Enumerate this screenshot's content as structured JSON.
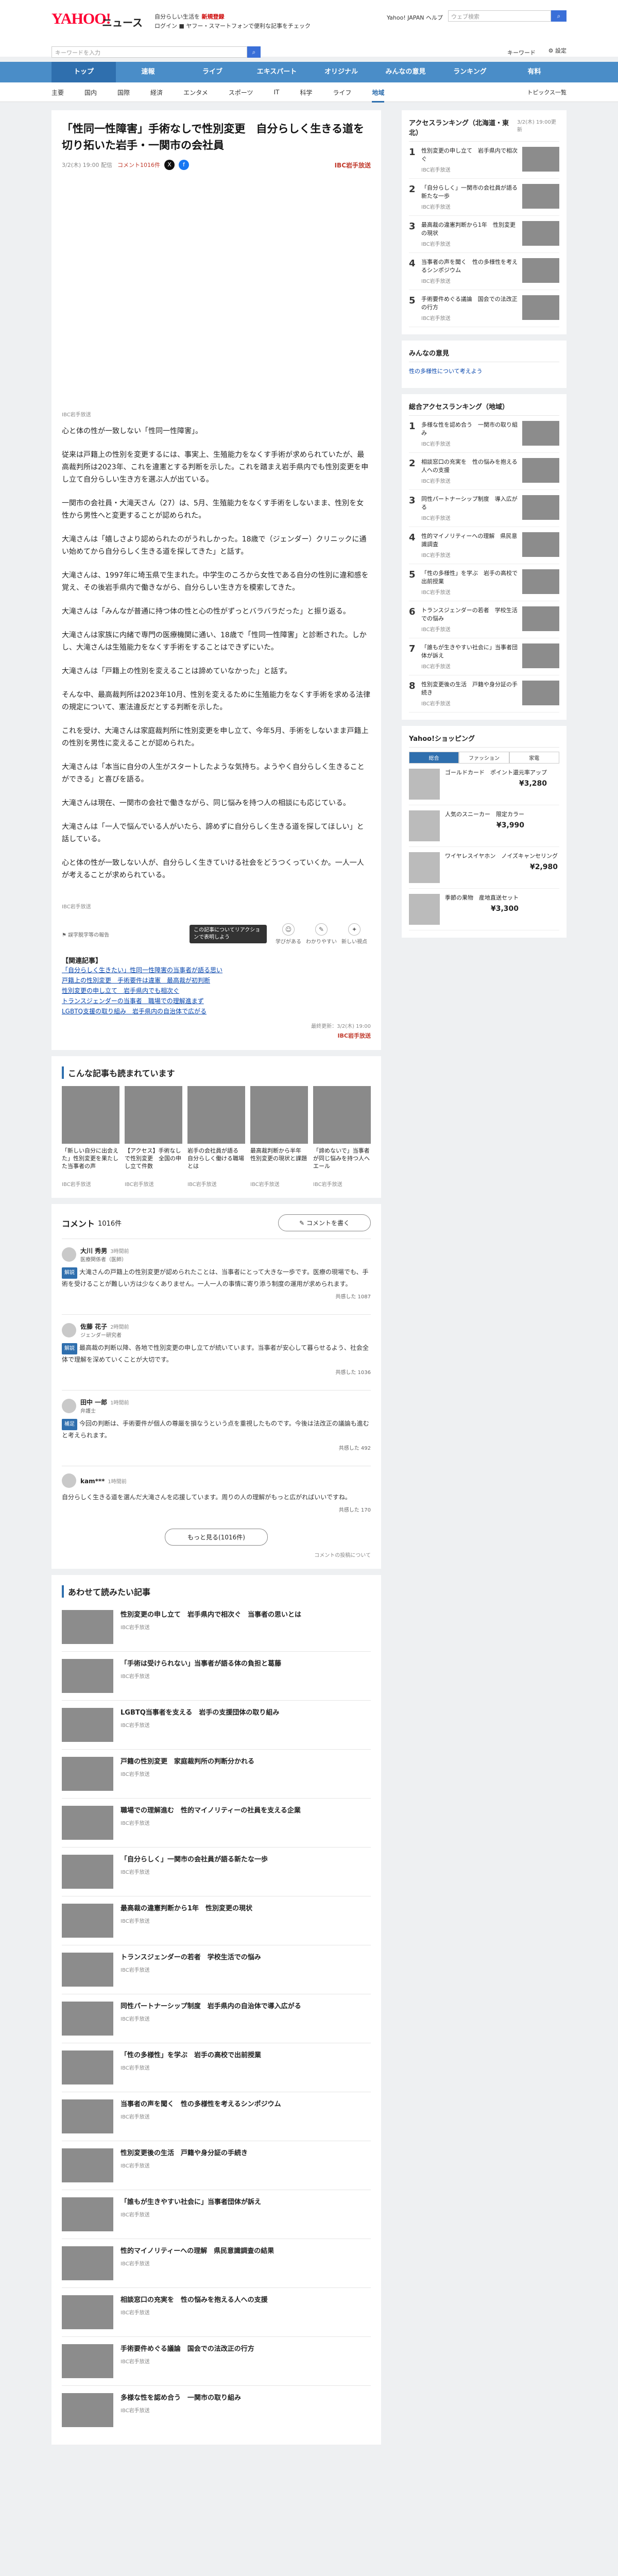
{
  "header": {
    "logo": "YAHOO!",
    "logo_news": "ニュース",
    "promo_line1_pre": "自分らしい生活を",
    "promo_line1_strong": "新規登録",
    "promo_line2": "ログイン ■ ヤフー・スマートフォンで便利な記事をチェック",
    "top_links": "Yahoo! JAPAN ヘルプ",
    "top_search_placeholder": "ウェブ検索",
    "news_search_placeholder": "キーワードを入力",
    "keywords": "キーワード",
    "settings": "設定"
  },
  "nav": {
    "items": [
      "トップ",
      "速報",
      "ライブ",
      "エキスパート",
      "オリジナル",
      "みんなの意見",
      "ランキング",
      "有料"
    ],
    "active": 0
  },
  "subnav": {
    "items": [
      "主要",
      "国内",
      "国際",
      "経済",
      "エンタメ",
      "スポーツ",
      "IT",
      "科学",
      "ライフ",
      "地域"
    ],
    "active": 9,
    "topics_link": "トピックス一覧"
  },
  "article": {
    "title": "「性同一性障害」手術なしで性別変更　自分らしく生きる道を切り拓いた岩手・一関市の会社員",
    "date": "3/2(木) 19:00 配信",
    "comments_label": "コメント1016件",
    "source": "IBC岩手放送",
    "video_caption": "IBC岩手放送",
    "paragraphs": [
      "心と体の性が一致しない「性同一性障害」。",
      "従来は戸籍上の性別を変更するには、事実上、生殖能力をなくす手術が求められていたが、最高裁判所は2023年、これを違憲とする判断を示した。これを踏まえ岩手県内でも性別変更を申し立て自分らしい生き方を選ぶ人が出ている。",
      "一関市の会社員・大滝天さん（27）は、5月、生殖能力をなくす手術をしないまま、性別を女性から男性へと変更することが認められた。",
      "大滝さんは「嬉しさより認められたのがうれしかった。18歳で（ジェンダー）クリニックに通い始めてから自分らしく生きる道を探してきた」と話す。",
      "大滝さんは、1997年に埼玉県で生まれた。中学生のころから女性である自分の性別に違和感を覚え、その後岩手県内で働きながら、自分らしい生き方を模索してきた。",
      "大滝さんは「みんなが普通に持つ体の性と心の性がずっとバラバラだった」と振り返る。",
      "大滝さんは家族に内緒で専門の医療機関に通い、18歳で「性同一性障害」と診断された。しかし、大滝さんは生殖能力をなくす手術をすることはできずにいた。",
      "大滝さんは「戸籍上の性別を変えることは諦めていなかった」と話す。",
      "そんな中、最高裁判所は2023年10月、性別を変えるために生殖能力をなくす手術を求める法律の規定について、憲法違反だとする判断を示した。",
      "これを受け、大滝さんは家庭裁判所に性別変更を申し立て、今年5月、手術をしないまま戸籍上の性別を男性に変えることが認められた。",
      "大滝さんは「本当に自分の人生がスタートしたような気持ち。ようやく自分らしく生きることができる」と喜びを語る。",
      "大滝さんは現在、一関市の会社で働きながら、同じ悩みを持つ人の相談にも応じている。",
      "大滝さんは「一人で悩んでいる人がいたら、諦めずに自分らしく生きる道を探してほしい」と話している。",
      "心と体の性が一致しない人が、自分らしく生きていける社会をどうつくっていくか。一人一人が考えることが求められている。"
    ],
    "end_source": "IBC岩手放送",
    "error_report": "誤字脱字等の報告",
    "tooltip": "この記事についてリアクションで表明しよう",
    "reactions": [
      {
        "icon": "☺",
        "label": "学びがある"
      },
      {
        "icon": "✎",
        "label": "わかりやすい"
      },
      {
        "icon": "✦",
        "label": "新しい視点"
      }
    ],
    "related_heading": "【関連記事】",
    "related": [
      "「自分らしく生きたい」性同一性障害の当事者が語る思い",
      "戸籍上の性別変更　手術要件は違憲　最高裁が初判断",
      "性別変更の申し立て　岩手県内でも相次ぐ",
      "トランスジェンダーの当事者　職場での理解進まず",
      "LGBTQ支援の取り組み　岩手県内の自治体で広がる"
    ],
    "timestamp": "最終更新：3/2(木) 19:00",
    "timestamp_source": "IBC岩手放送"
  },
  "recommend": {
    "heading": "こんな記事も読まれています",
    "items": [
      {
        "title": "「新しい自分に出会えた」性別変更を果たした当事者の声",
        "source": "IBC岩手放送"
      },
      {
        "title": "【アクセス】手術なしで性別変更　全国の申し立て件数",
        "source": "IBC岩手放送"
      },
      {
        "title": "岩手の会社員が語る　自分らしく働ける職場とは",
        "source": "IBC岩手放送"
      },
      {
        "title": "最高裁判断から半年　性別変更の現状と課題",
        "source": "IBC岩手放送"
      },
      {
        "title": "「諦めないで」当事者が同じ悩みを持つ人へエール",
        "source": "IBC岩手放送"
      }
    ]
  },
  "comments": {
    "title": "コメント",
    "count": "1016件",
    "write_button": "コメントを書く",
    "items": [
      {
        "name": "大川 秀男",
        "time": "3時間前",
        "role": "医療関係者（医師）",
        "tag": "解説",
        "text": "大滝さんの戸籍上の性別変更が認められたことは、当事者にとって大きな一歩です。医療の現場でも、手術を受けることが難しい方は少なくありません。一人一人の事情に寄り添う制度の運用が求められます。",
        "likes": "共感した 1087"
      },
      {
        "name": "佐藤 花子",
        "time": "2時間前",
        "role": "ジェンダー研究者",
        "tag": "解説",
        "text": "最高裁の判断以降、各地で性別変更の申し立てが続いています。当事者が安心して暮らせるよう、社会全体で理解を深めていくことが大切です。",
        "likes": "共感した 1036"
      },
      {
        "name": "田中 一郎",
        "time": "1時間前",
        "role": "弁護士",
        "tag": "補足",
        "text": "今回の判断は、手術要件が個人の尊厳を損なうという点を重視したものです。今後は法改正の議論も進むと考えられます。",
        "likes": "共感した 492"
      },
      {
        "name": "kam***",
        "time": "1時間前",
        "role": "",
        "tag": "",
        "text": "自分らしく生きる道を選んだ大滝さんを応援しています。周りの人の理解がもっと広がればいいですね。",
        "likes": "共感した 170"
      }
    ],
    "more_button": "もっと見る(1016件)",
    "note": "コメントの投稿について"
  },
  "also_read": {
    "heading": "あわせて読みたい記事",
    "items": [
      {
        "title": "性別変更の申し立て　岩手県内で相次ぐ　当事者の思いとは",
        "source": "IBC岩手放送"
      },
      {
        "title": "「手術は受けられない」当事者が語る体の負担と葛藤",
        "source": "IBC岩手放送"
      },
      {
        "title": "LGBTQ当事者を支える　岩手の支援団体の取り組み",
        "source": "IBC岩手放送"
      },
      {
        "title": "戸籍の性別変更　家庭裁判所の判断分かれる",
        "source": "IBC岩手放送"
      },
      {
        "title": "職場での理解進む　性的マイノリティーの社員を支える企業",
        "source": "IBC岩手放送"
      },
      {
        "title": "「自分らしく」一関市の会社員が語る新たな一歩",
        "source": "IBC岩手放送"
      },
      {
        "title": "最高裁の違憲判断から1年　性別変更の現状",
        "source": "IBC岩手放送"
      },
      {
        "title": "トランスジェンダーの若者　学校生活での悩み",
        "source": "IBC岩手放送"
      },
      {
        "title": "同性パートナーシップ制度　岩手県内の自治体で導入広がる",
        "source": "IBC岩手放送"
      },
      {
        "title": "「性の多様性」を学ぶ　岩手の高校で出前授業",
        "source": "IBC岩手放送"
      },
      {
        "title": "当事者の声を聞く　性の多様性を考えるシンポジウム",
        "source": "IBC岩手放送"
      },
      {
        "title": "性別変更後の生活　戸籍や身分証の手続き",
        "source": "IBC岩手放送"
      },
      {
        "title": "「誰もが生きやすい社会に」当事者団体が訴え",
        "source": "IBC岩手放送"
      },
      {
        "title": "性的マイノリティーへの理解　県民意識調査の結果",
        "source": "IBC岩手放送"
      },
      {
        "title": "相談窓口の充実を　性の悩みを抱える人への支援",
        "source": "IBC岩手放送"
      },
      {
        "title": "手術要件めぐる議論　国会での法改正の行方",
        "source": "IBC岩手放送"
      },
      {
        "title": "多様な性を認め合う　一関市の取り組み",
        "source": "IBC岩手放送"
      }
    ]
  },
  "sidebar": {
    "ranking_heading": "アクセスランキング（北海道・東北）",
    "ranking_update": "3/2(木) 19:00更新",
    "ranking": [
      {
        "no": "1",
        "title": "性別変更の申し立て　岩手県内で相次ぐ",
        "source": "IBC岩手放送"
      },
      {
        "title": "「自分らしく」一関市の会社員が語る新たな一歩",
        "no": "2",
        "source": "IBC岩手放送"
      },
      {
        "no": "3",
        "title": "最高裁の違憲判断から1年　性別変更の現状",
        "source": "IBC岩手放送"
      },
      {
        "no": "4",
        "title": "当事者の声を聞く　性の多様性を考えるシンポジウム",
        "source": "IBC岩手放送"
      },
      {
        "no": "5",
        "title": "手術要件めぐる議論　国会での法改正の行方",
        "source": "IBC岩手放送"
      }
    ],
    "opinion_heading": "みんなの意見",
    "opinion_text": "性の多様性について考えよう",
    "ranking2_heading": "総合アクセスランキング（地域）",
    "ranking2": [
      {
        "no": "1",
        "title": "多様な性を認め合う　一関市の取り組み",
        "source": "IBC岩手放送"
      },
      {
        "no": "2",
        "title": "相談窓口の充実を　性の悩みを抱える人への支援",
        "source": "IBC岩手放送"
      },
      {
        "no": "3",
        "title": "同性パートナーシップ制度　導入広がる",
        "source": "IBC岩手放送"
      },
      {
        "no": "4",
        "title": "性的マイノリティーへの理解　県民意識調査",
        "source": "IBC岩手放送"
      },
      {
        "no": "5",
        "title": "「性の多様性」を学ぶ　岩手の高校で出前授業",
        "source": "IBC岩手放送"
      },
      {
        "no": "6",
        "title": "トランスジェンダーの若者　学校生活での悩み",
        "source": "IBC岩手放送"
      },
      {
        "no": "7",
        "title": "「誰もが生きやすい社会に」当事者団体が訴え",
        "source": "IBC岩手放送"
      },
      {
        "no": "8",
        "title": "性別変更後の生活　戸籍や身分証の手続き",
        "source": "IBC岩手放送"
      }
    ],
    "shopping_heading": "Yahoo!ショッピング",
    "shopping_tabs": [
      "総合",
      "ファッション",
      "家電"
    ],
    "products": [
      {
        "title": "ゴールドカード　ポイント還元率アップ",
        "price": "¥3,280"
      },
      {
        "title": "人気のスニーカー　限定カラー",
        "price": "¥3,990"
      },
      {
        "title": "ワイヤレスイヤホン　ノイズキャンセリング",
        "price": "¥2,980"
      },
      {
        "title": "季節の果物　産地直送セット",
        "price": "¥3,300"
      }
    ]
  },
  "colors": {
    "nav": "#4a8dc8",
    "accent": "#2f6fae",
    "brand": "#ff0033"
  }
}
